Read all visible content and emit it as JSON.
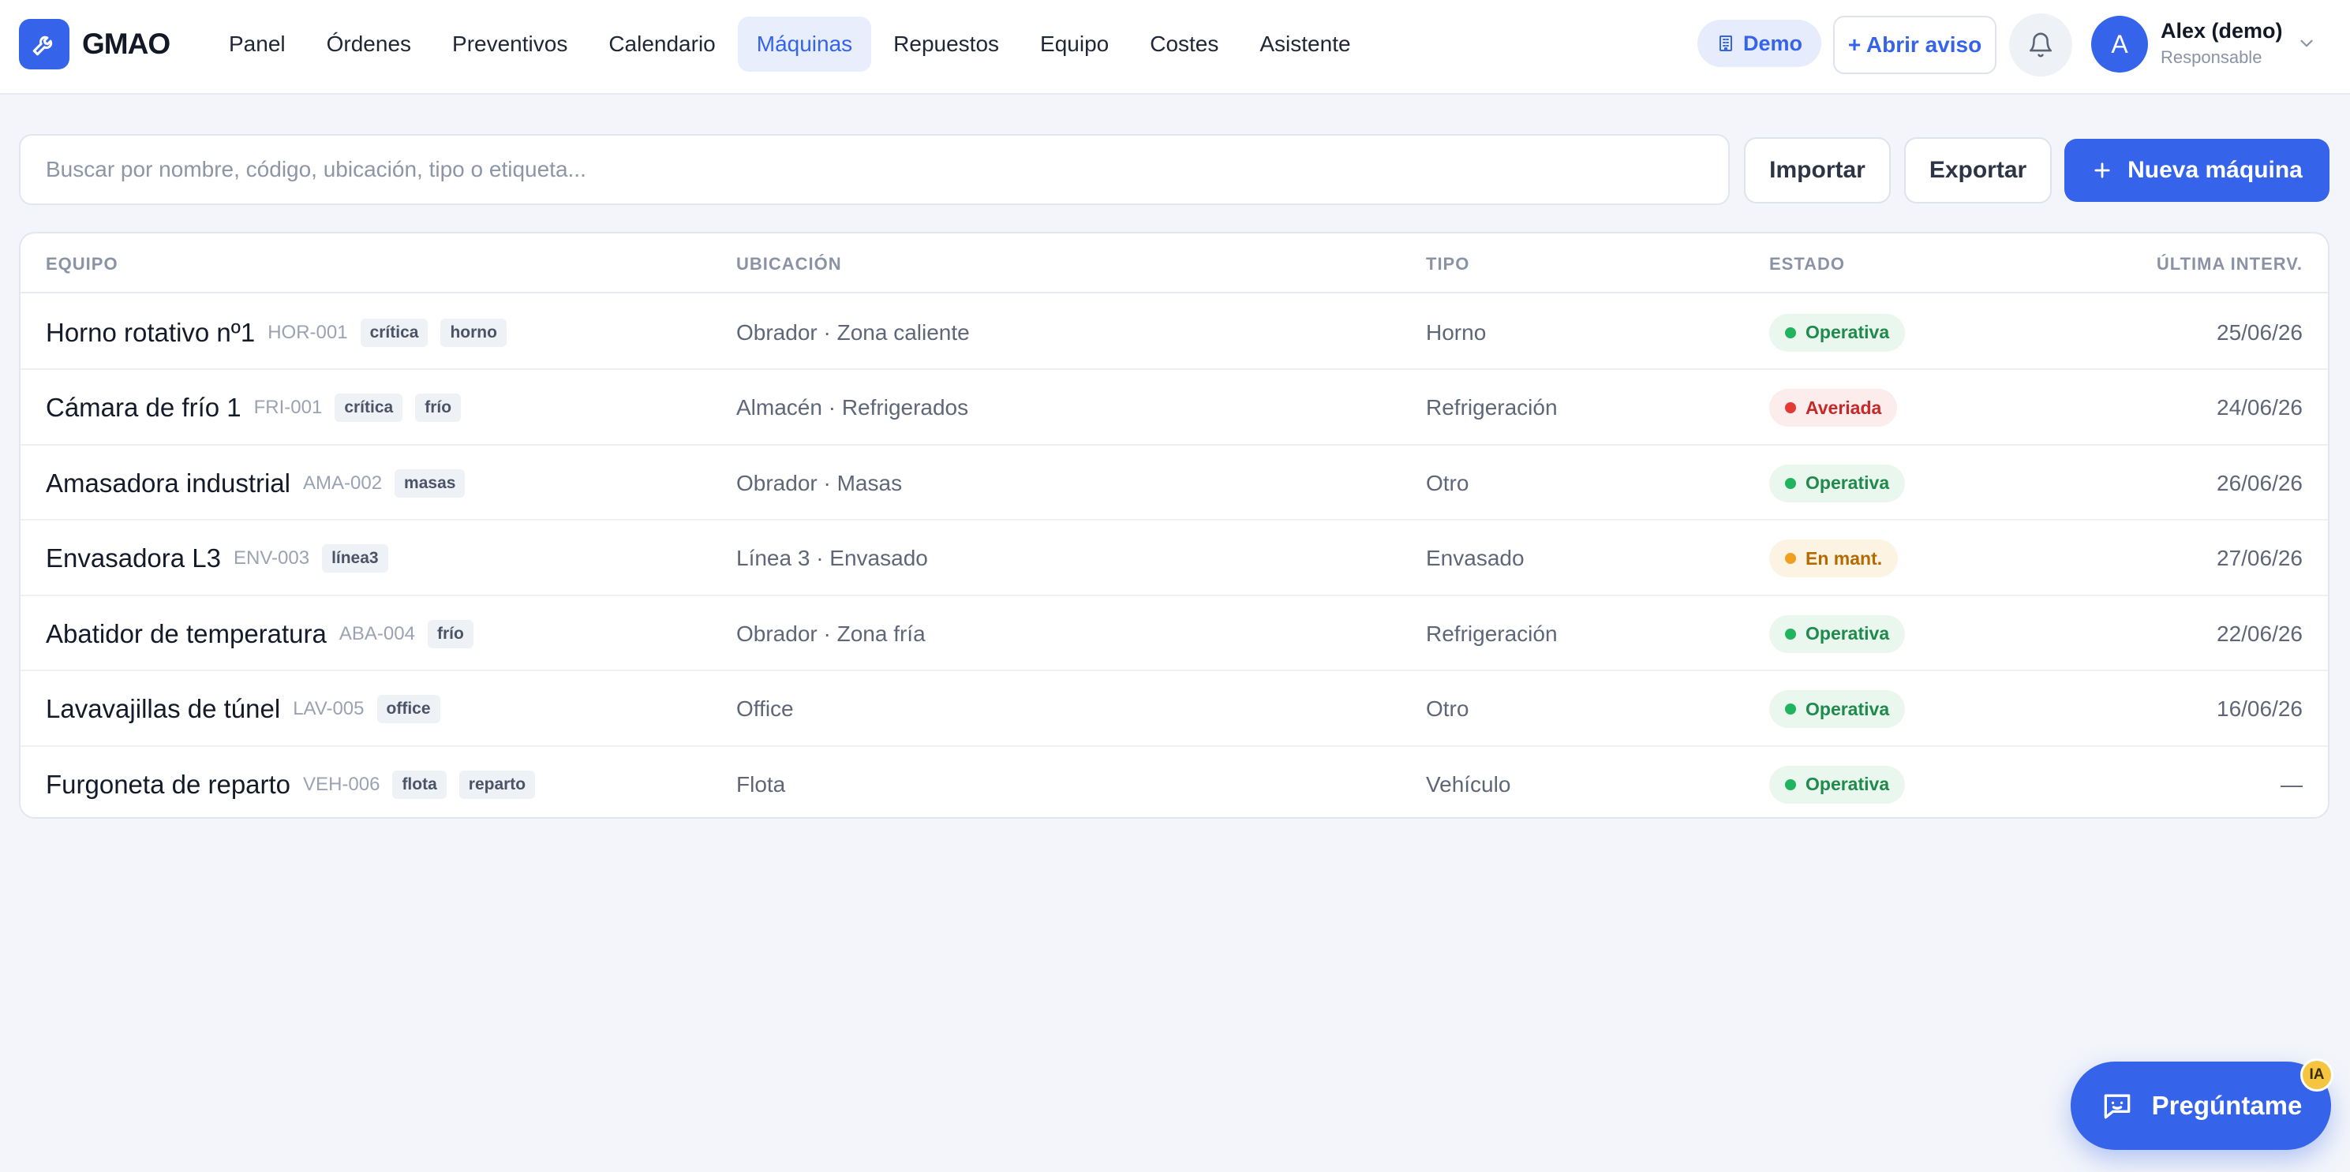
{
  "app": {
    "brand": "GMAO"
  },
  "nav": [
    {
      "label": "Panel",
      "active": false
    },
    {
      "label": "Órdenes",
      "active": false
    },
    {
      "label": "Preventivos",
      "active": false
    },
    {
      "label": "Calendario",
      "active": false
    },
    {
      "label": "Máquinas",
      "active": true
    },
    {
      "label": "Repuestos",
      "active": false
    },
    {
      "label": "Equipo",
      "active": false
    },
    {
      "label": "Costes",
      "active": false
    },
    {
      "label": "Asistente",
      "active": false
    }
  ],
  "header": {
    "demo_label": "Demo",
    "report_label": "+ Abrir aviso",
    "user": {
      "initial": "A",
      "name": "Alex (demo)",
      "role": "Responsable"
    }
  },
  "toolbar": {
    "search_placeholder": "Buscar por nombre, código, ubicación, tipo o etiqueta...",
    "import_label": "Importar",
    "export_label": "Exportar",
    "new_label": "Nueva máquina"
  },
  "table": {
    "columns": {
      "equipment": "EQUIPO",
      "location": "UBICACIÓN",
      "type": "TIPO",
      "state": "ESTADO",
      "last": "ÚLTIMA INTERV."
    },
    "rows": [
      {
        "name": "Horno rotativo nº1",
        "code": "HOR-001",
        "tags": [
          "crítica",
          "horno"
        ],
        "location": "Obrador · Zona caliente",
        "type": "Horno",
        "status": "Operativa",
        "status_kind": "ok",
        "last": "25/06/26"
      },
      {
        "name": "Cámara de frío 1",
        "code": "FRI-001",
        "tags": [
          "crítica",
          "frío"
        ],
        "location": "Almacén · Refrigerados",
        "type": "Refrigeración",
        "status": "Averiada",
        "status_kind": "bad",
        "last": "24/06/26"
      },
      {
        "name": "Amasadora industrial",
        "code": "AMA-002",
        "tags": [
          "masas"
        ],
        "location": "Obrador · Masas",
        "type": "Otro",
        "status": "Operativa",
        "status_kind": "ok",
        "last": "26/06/26"
      },
      {
        "name": "Envasadora L3",
        "code": "ENV-003",
        "tags": [
          "línea3"
        ],
        "location": "Línea 3 · Envasado",
        "type": "Envasado",
        "status": "En mant.",
        "status_kind": "warn",
        "last": "27/06/26"
      },
      {
        "name": "Abatidor de temperatura",
        "code": "ABA-004",
        "tags": [
          "frío"
        ],
        "location": "Obrador · Zona fría",
        "type": "Refrigeración",
        "status": "Operativa",
        "status_kind": "ok",
        "last": "22/06/26"
      },
      {
        "name": "Lavavajillas de túnel",
        "code": "LAV-005",
        "tags": [
          "office"
        ],
        "location": "Office",
        "type": "Otro",
        "status": "Operativa",
        "status_kind": "ok",
        "last": "16/06/26"
      },
      {
        "name": "Furgoneta de reparto",
        "code": "VEH-006",
        "tags": [
          "flota",
          "reparto"
        ],
        "location": "Flota",
        "type": "Vehículo",
        "status": "Operativa",
        "status_kind": "ok",
        "last": "—"
      }
    ]
  },
  "status_colors": {
    "ok": {
      "bg": "#eaf7ef",
      "fg": "#1f8a4c",
      "dot": "#22b35e"
    },
    "bad": {
      "bg": "#fdecec",
      "fg": "#c62828",
      "dot": "#e53935"
    },
    "warn": {
      "bg": "#fdf3e3",
      "fg": "#b56a00",
      "dot": "#f0a020"
    }
  },
  "assistant": {
    "label": "Pregúntame",
    "badge": "IA"
  },
  "colors": {
    "accent": "#3563e9",
    "background": "#f3f5fa"
  },
  "icons": {
    "logo": "wrench-icon",
    "demo": "building-icon",
    "bell": "bell-icon",
    "chevron": "chevron-down-icon",
    "plus": "plus-icon",
    "chat": "chat-icon"
  }
}
